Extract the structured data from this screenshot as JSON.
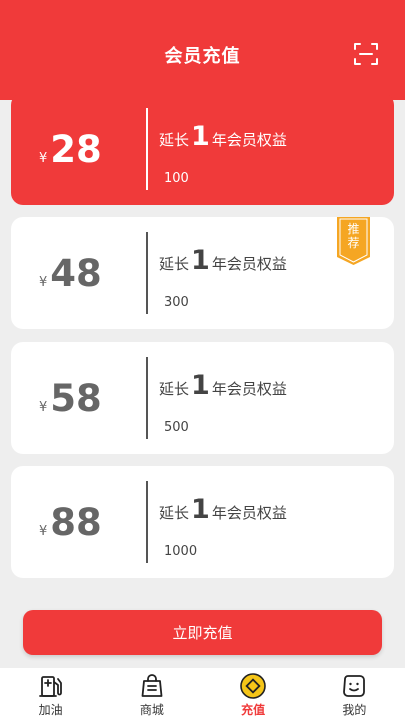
{
  "header": {
    "title": "会员充值",
    "scan_icon": "scan-icon"
  },
  "plans": [
    {
      "currency": "¥",
      "price": "28",
      "benefit_prefix": "延长",
      "benefit_num": "1",
      "benefit_suffix": "年会员权益",
      "amount": "100",
      "selected": true
    },
    {
      "currency": "¥",
      "price": "48",
      "benefit_prefix": "延长",
      "benefit_num": "1",
      "benefit_suffix": "年会员权益",
      "amount": "300",
      "badge_line1": "推",
      "badge_line2": "荐"
    },
    {
      "currency": "¥",
      "price": "58",
      "benefit_prefix": "延长",
      "benefit_num": "1",
      "benefit_suffix": "年会员权益",
      "amount": "500"
    },
    {
      "currency": "¥",
      "price": "88",
      "benefit_prefix": "延长",
      "benefit_num": "1",
      "benefit_suffix": "年会员权益",
      "amount": "1000"
    }
  ],
  "recharge_button": "立即充值",
  "nav": [
    {
      "label": "加油",
      "icon": "fuel-pump-icon"
    },
    {
      "label": "商城",
      "icon": "shopping-bag-icon"
    },
    {
      "label": "充值",
      "icon": "coin-icon",
      "active": true
    },
    {
      "label": "我的",
      "icon": "profile-face-icon"
    }
  ],
  "colors": {
    "brand_red": "#f03a3a",
    "badge_gold": "#f5a623",
    "card_bg": "#ffffff",
    "page_bg": "#eeeeee"
  }
}
